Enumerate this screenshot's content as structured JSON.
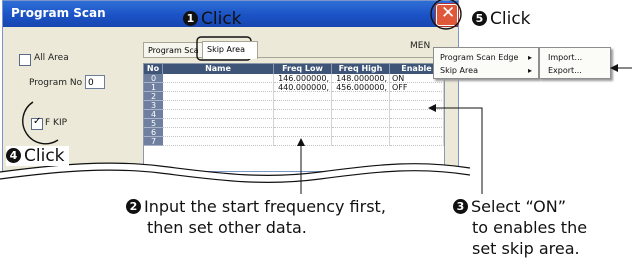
{
  "window": {
    "title": "Program Scan",
    "menu_label": "MEN"
  },
  "left_panel": {
    "all_area_label": "All Area",
    "program_no_label": "Program No",
    "program_no_value": "0",
    "skip_label": "F   KIP",
    "skip_checked": true
  },
  "tabs": [
    {
      "label": "Program Sca",
      "active": false
    },
    {
      "label": "Skip Area",
      "active": true
    }
  ],
  "table": {
    "headers": [
      "No",
      "Name",
      "Freq Low",
      "Freq High",
      "Enable"
    ],
    "rows": [
      {
        "no": "0",
        "name": "",
        "freq_low": "146.000000,",
        "freq_high": "148.000000,",
        "enable": "ON"
      },
      {
        "no": "1",
        "name": "",
        "freq_low": "440.000000,",
        "freq_high": "456.000000,",
        "enable": "OFF"
      },
      {
        "no": "2",
        "name": "",
        "freq_low": "",
        "freq_high": "",
        "enable": ""
      },
      {
        "no": "3",
        "name": "",
        "freq_low": "",
        "freq_high": "",
        "enable": ""
      },
      {
        "no": "4",
        "name": "",
        "freq_low": "",
        "freq_high": "",
        "enable": ""
      },
      {
        "no": "5",
        "name": "",
        "freq_low": "",
        "freq_high": "",
        "enable": ""
      },
      {
        "no": "6",
        "name": "",
        "freq_low": "",
        "freq_high": "",
        "enable": ""
      },
      {
        "no": "7",
        "name": "",
        "freq_low": "",
        "freq_high": "",
        "enable": ""
      }
    ]
  },
  "context_menu": {
    "items": [
      {
        "label": "Program Scan Edge",
        "arrow": "▸"
      },
      {
        "label": "Skip Area",
        "arrow": "▸"
      }
    ],
    "submenu": [
      {
        "label": "Import..."
      },
      {
        "label": "Export..."
      }
    ]
  },
  "callouts": {
    "c1": {
      "num": "1",
      "text": "Click"
    },
    "c2": {
      "num": "2",
      "lines": [
        "Input the start frequency first,",
        "then set other data."
      ]
    },
    "c3": {
      "num": "3",
      "lines": [
        "Select   “ON”",
        "to enables the",
        "set skip area."
      ]
    },
    "c4": {
      "num": "4",
      "text": "Click"
    },
    "c5": {
      "num": "5",
      "text": "Click"
    }
  },
  "colors": {
    "titlebar": "#1b53c6",
    "close_button": "#e0583a",
    "header": "#3e5577"
  }
}
